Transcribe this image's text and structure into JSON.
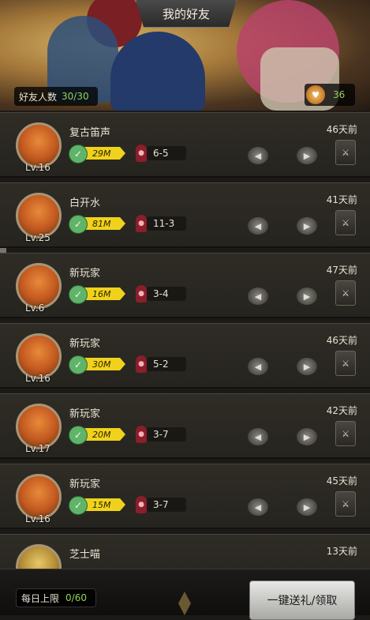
{
  "header": {
    "title": "我的好友",
    "friend_count_label": "好友人数",
    "friend_count_value": "30/30",
    "coin_value": "36"
  },
  "friends": [
    {
      "name": "复古笛声",
      "level": "Lv.16",
      "power": "29M",
      "stage": "6-5",
      "days": "46天前"
    },
    {
      "name": "白开水",
      "level": "Lv.25",
      "power": "81M",
      "stage": "11-3",
      "days": "41天前"
    },
    {
      "name": "新玩家",
      "level": "Lv.6",
      "power": "16M",
      "stage": "3-4",
      "days": "47天前"
    },
    {
      "name": "新玩家",
      "level": "Lv.16",
      "power": "30M",
      "stage": "5-2",
      "days": "46天前"
    },
    {
      "name": "新玩家",
      "level": "Lv.17",
      "power": "20M",
      "stage": "3-7",
      "days": "42天前"
    },
    {
      "name": "新玩家",
      "level": "Lv.16",
      "power": "15M",
      "stage": "3-7",
      "days": "45天前"
    },
    {
      "name": "芝士喵",
      "level": "",
      "power": "",
      "stage": "",
      "days": "13天前"
    }
  ],
  "footer": {
    "daily_limit_label": "每日上限",
    "daily_limit_value": "0/60",
    "gift_button_label": "一键送礼/领取"
  }
}
